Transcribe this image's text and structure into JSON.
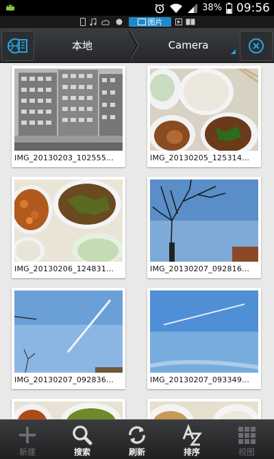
{
  "status_bar": {
    "battery": "38%",
    "time": "09:56",
    "icons": [
      "android-icon",
      "alarm-icon",
      "wifi-icon",
      "signal-icon",
      "battery-icon"
    ]
  },
  "tab_strip": {
    "active_label": "图片",
    "icons": [
      "phone-icon",
      "music-icon",
      "cloud-icon",
      "film-icon",
      "book-icon"
    ]
  },
  "nav": {
    "breadcrumb": [
      "本地",
      "Camera"
    ],
    "left_icon": "panel-toggle-icon",
    "right_icon": "close-circle-icon",
    "accent": "#2aa0e6"
  },
  "images": [
    {
      "filename": "IMG_20130203_102555..."
    },
    {
      "filename": "IMG_20130205_125314..."
    },
    {
      "filename": "IMG_20130206_124831..."
    },
    {
      "filename": "IMG_20130207_092816..."
    },
    {
      "filename": "IMG_20130207_092836..."
    },
    {
      "filename": "IMG_20130207_093349..."
    }
  ],
  "toolbar": {
    "items": [
      {
        "label": "新建",
        "icon": "plus-icon",
        "enabled": false
      },
      {
        "label": "搜索",
        "icon": "search-icon",
        "enabled": true
      },
      {
        "label": "刷新",
        "icon": "refresh-icon",
        "enabled": true
      },
      {
        "label": "排序",
        "icon": "sort-az-icon",
        "enabled": true
      },
      {
        "label": "视图",
        "icon": "grid-view-icon",
        "enabled": false
      }
    ]
  }
}
